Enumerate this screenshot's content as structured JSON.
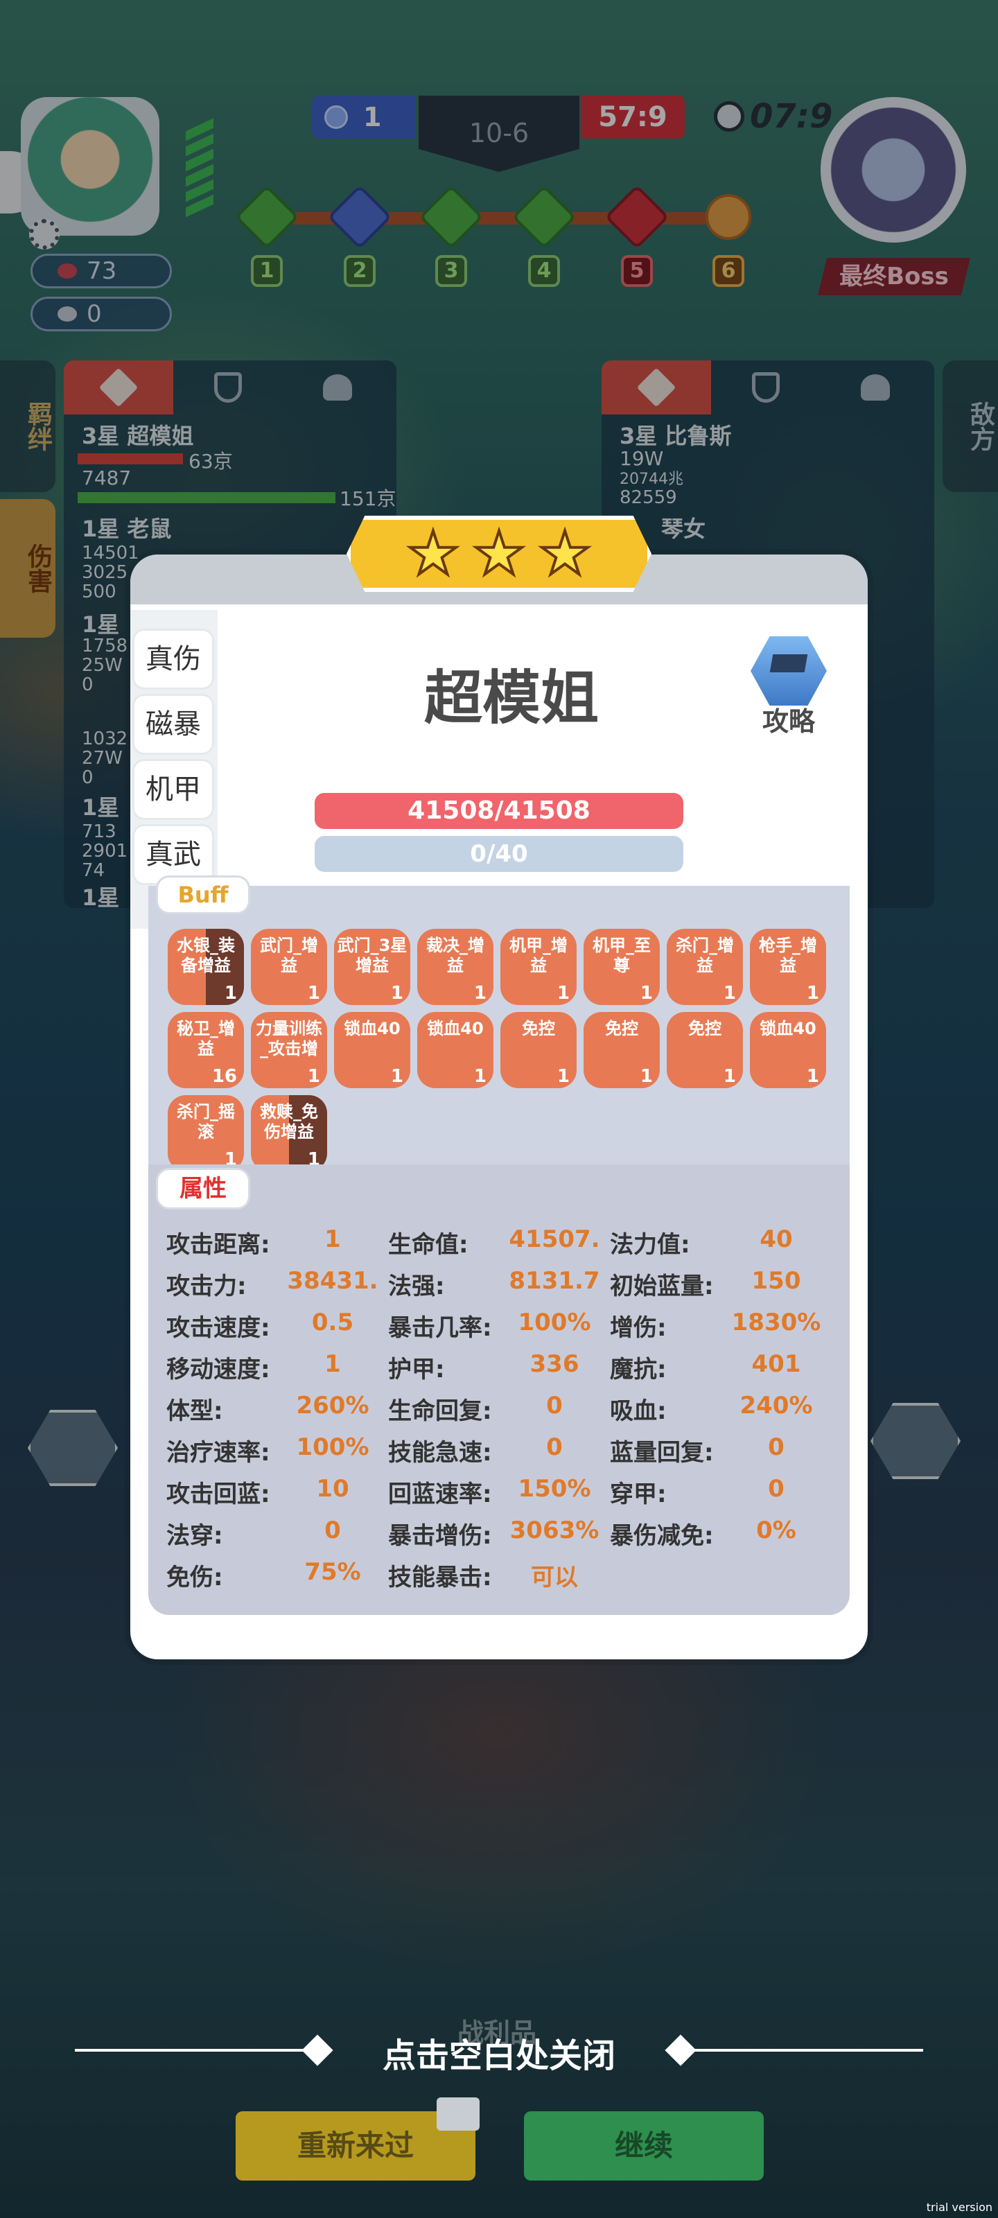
{
  "hud": {
    "blue_score": "1",
    "stage": "10-6",
    "red_score": "57:9",
    "timer": "07:9",
    "boss_label": "最终Boss",
    "player_hearts": "73",
    "player_coins": "0"
  },
  "stages": [
    {
      "num": "1",
      "type": "green"
    },
    {
      "num": "2",
      "type": "blue"
    },
    {
      "num": "3",
      "type": "green"
    },
    {
      "num": "4",
      "type": "green"
    },
    {
      "num": "5",
      "type": "red"
    },
    {
      "num": "6",
      "type": "skull"
    }
  ],
  "left_panel": {
    "tab_bond": "羁绊",
    "tab_damage": "伤害",
    "row1_name": "3星 超模姐",
    "row1_red_val": "63京",
    "row1_sub": "7487",
    "row1_green_val": "151京",
    "row2_name": "1星 老鼠",
    "row2_lines": [
      "14501",
      "3025",
      "500"
    ],
    "row3_name": "1星",
    "row3_lines": [
      "1758",
      "25W",
      "0"
    ],
    "row4_lines": [
      "1032",
      "27W",
      "0"
    ],
    "row5_name": "1星",
    "row5_lines": [
      "713",
      "2901",
      "74"
    ],
    "row6_name": "1星"
  },
  "right_panel": {
    "tab_enemy": "敌方",
    "row1_name": "3星 比鲁斯",
    "row1_val1": "19W",
    "row1_val2": "20744兆",
    "row1_val3": "82559",
    "row2_name": "琴女"
  },
  "modal": {
    "stars": [
      "★",
      "★",
      "★"
    ],
    "hero_name": "超模姐",
    "guide_label": "攻略",
    "tags": [
      "真伤",
      "磁暴",
      "机甲",
      "真武"
    ],
    "hp": "41508/41508",
    "mp": "0/40",
    "buff_title": "Buff",
    "buffs": [
      {
        "name": "水银_装备增益",
        "count": "1",
        "split": true
      },
      {
        "name": "武门_增益",
        "count": "1",
        "split": false
      },
      {
        "name": "武门_3星增益",
        "count": "1",
        "split": false
      },
      {
        "name": "裁决_增益",
        "count": "1",
        "split": false
      },
      {
        "name": "机甲_增益",
        "count": "1",
        "split": false
      },
      {
        "name": "机甲_至尊",
        "count": "1",
        "split": false
      },
      {
        "name": "杀门_增益",
        "count": "1",
        "split": false
      },
      {
        "name": "枪手_增益",
        "count": "1",
        "split": false
      },
      {
        "name": "秘卫_增益",
        "count": "16",
        "split": false
      },
      {
        "name": "力量训练_攻击增",
        "count": "1",
        "split": false
      },
      {
        "name": "锁血40",
        "count": "1",
        "split": false
      },
      {
        "name": "锁血40",
        "count": "1",
        "split": false
      },
      {
        "name": "免控",
        "count": "1",
        "split": false
      },
      {
        "name": "免控",
        "count": "1",
        "split": false
      },
      {
        "name": "免控",
        "count": "1",
        "split": false
      },
      {
        "name": "锁血40",
        "count": "1",
        "split": false
      },
      {
        "name": "杀门_摇滚",
        "count": "1",
        "split": false
      },
      {
        "name": "救赎_免伤增益",
        "count": "1",
        "split": true
      }
    ],
    "attr_title": "属性",
    "attributes": [
      [
        {
          "k": "攻击距离:",
          "v": "1"
        },
        {
          "k": "生命值:",
          "v": "41507."
        },
        {
          "k": "法力值:",
          "v": "40"
        }
      ],
      [
        {
          "k": "攻击力:",
          "v": "38431."
        },
        {
          "k": "法强:",
          "v": "8131.7"
        },
        {
          "k": "初始蓝量:",
          "v": "150"
        }
      ],
      [
        {
          "k": "攻击速度:",
          "v": "0.5"
        },
        {
          "k": "暴击几率:",
          "v": "100%"
        },
        {
          "k": "增伤:",
          "v": "1830%"
        }
      ],
      [
        {
          "k": "移动速度:",
          "v": "1"
        },
        {
          "k": "护甲:",
          "v": "336"
        },
        {
          "k": "魔抗:",
          "v": "401"
        }
      ],
      [
        {
          "k": "体型:",
          "v": "260%"
        },
        {
          "k": "生命回复:",
          "v": "0"
        },
        {
          "k": "吸血:",
          "v": "240%"
        }
      ],
      [
        {
          "k": "治疗速率:",
          "v": "100%"
        },
        {
          "k": "技能急速:",
          "v": "0"
        },
        {
          "k": "蓝量回复:",
          "v": "0"
        }
      ],
      [
        {
          "k": "攻击回蓝:",
          "v": "10"
        },
        {
          "k": "回蓝速率:",
          "v": "150%"
        },
        {
          "k": "穿甲:",
          "v": "0"
        }
      ],
      [
        {
          "k": "法穿:",
          "v": "0"
        },
        {
          "k": "暴击增伤:",
          "v": "3063%"
        },
        {
          "k": "暴伤减免:",
          "v": "0%"
        }
      ],
      [
        {
          "k": "免伤:",
          "v": "75%"
        },
        {
          "k": "技能暴击:",
          "v": "可以"
        },
        {
          "k": "",
          "v": ""
        }
      ]
    ]
  },
  "bottom": {
    "loot_text": "战利品",
    "close_hint": "点击空白处关闭",
    "retry_label": "重新来过",
    "continue_label": "继续",
    "watermark": "trial version"
  },
  "colors": {
    "accent_orange": "#e07a2a",
    "buff_orange": "#e77a54",
    "hp_red": "#f0646b",
    "mp_blue": "#c4d3e4"
  }
}
